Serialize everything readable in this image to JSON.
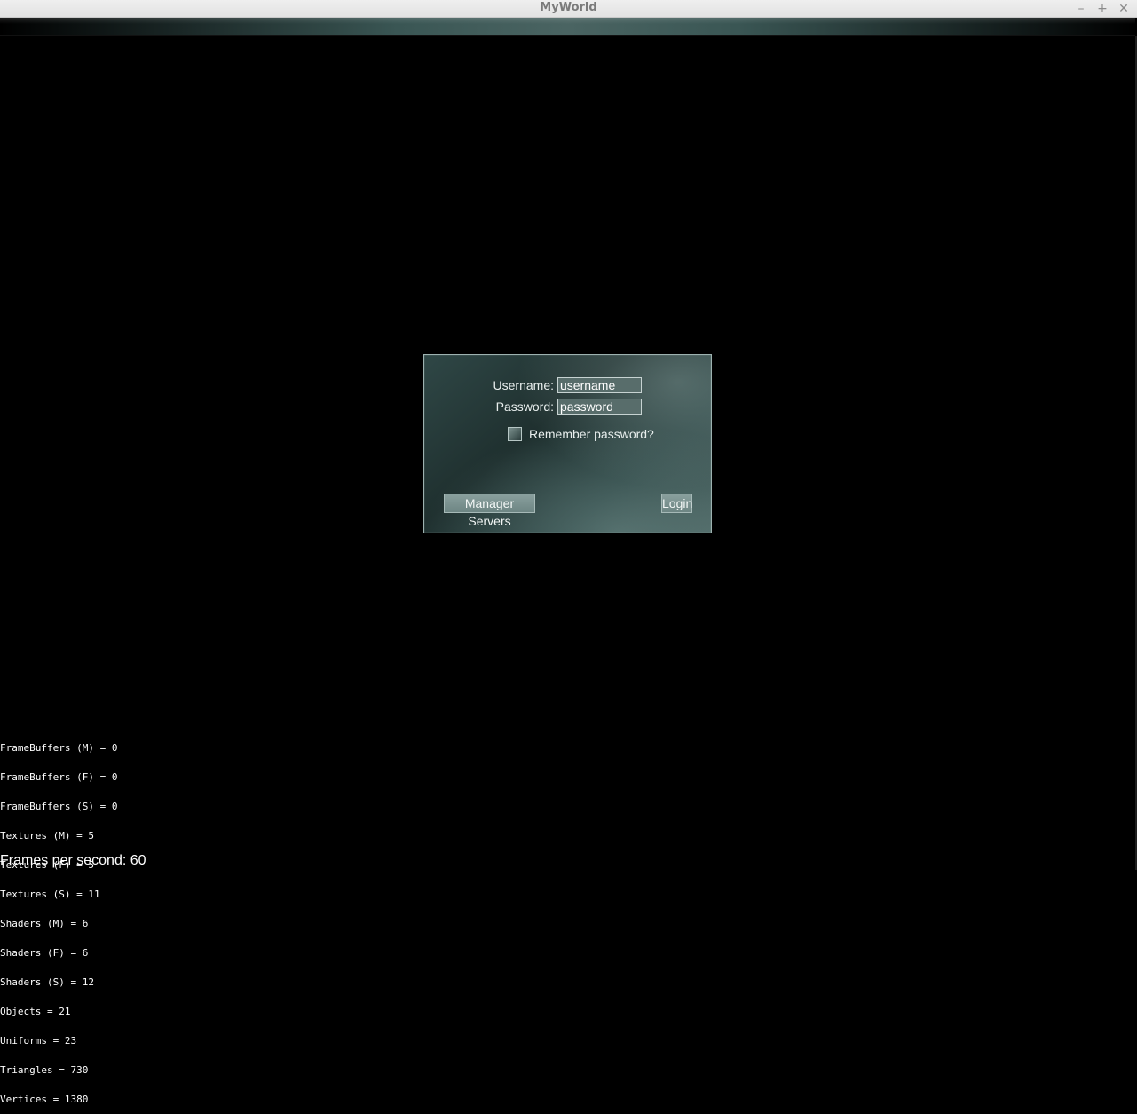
{
  "window": {
    "title": "MyWorld",
    "controls": {
      "minimize": "–",
      "maximize": "+",
      "close": "✕"
    }
  },
  "login": {
    "username_label": "Username:",
    "username_value": "username",
    "password_label": "Password:",
    "password_value": "password",
    "remember_label": "Remember password?",
    "remember_checked": false,
    "manage_servers_label": "Manager Servers",
    "login_label": "Login"
  },
  "stats": [
    "FrameBuffers (M) = 0",
    "FrameBuffers (F) = 0",
    "FrameBuffers (S) = 0",
    "Textures (M) = 5",
    "Textures (F) = 5",
    "Textures (S) = 11",
    "Shaders (M) = 6",
    "Shaders (F) = 6",
    "Shaders (S) = 12",
    "Objects = 21",
    "Uniforms = 23",
    "Triangles = 730",
    "Vertices = 1380"
  ],
  "fps_text": "Frames per second: 60",
  "colors": {
    "background": "#000000",
    "panel": "#2f4746",
    "text": "#e9efee"
  }
}
